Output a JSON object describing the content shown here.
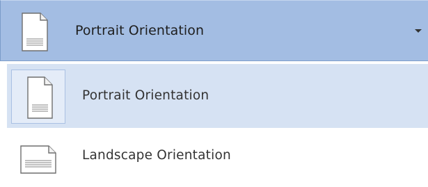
{
  "dropdown": {
    "selected_label": "Portrait Orientation",
    "icon": "portrait-page-icon",
    "caret_icon": "chevron-down-icon"
  },
  "menu": {
    "items": [
      {
        "label": "Portrait Orientation",
        "icon": "portrait-page-icon",
        "selected": true
      },
      {
        "label": "Landscape Orientation",
        "icon": "landscape-page-icon",
        "selected": false
      }
    ]
  },
  "colors": {
    "dropdown_bg": "#a3bde3",
    "selected_item_bg": "#d6e2f3",
    "text": "#333333"
  }
}
